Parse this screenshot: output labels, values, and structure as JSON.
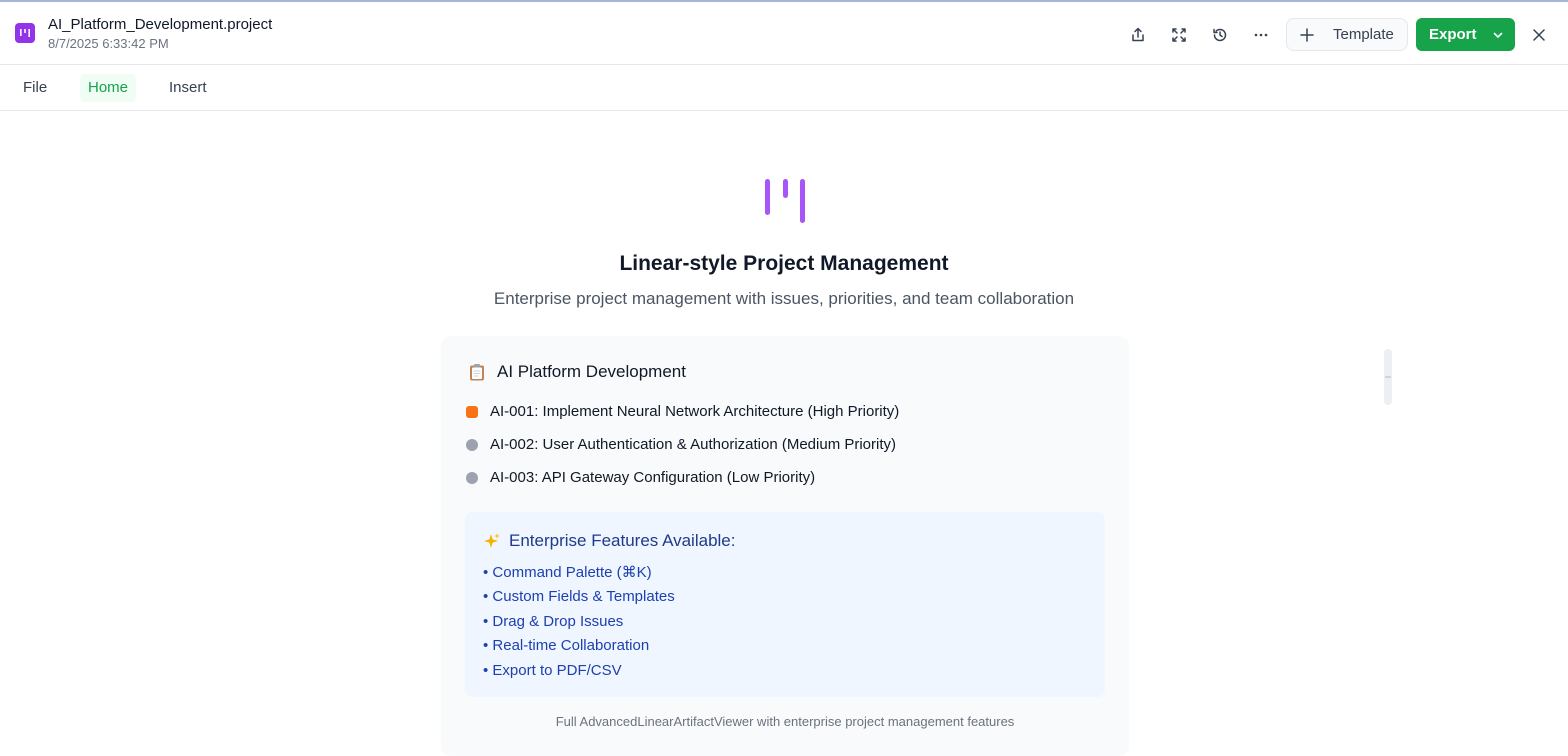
{
  "colors": {
    "accent_purple": "#9333ea",
    "export_green": "#16a34a",
    "priority_high": "#f97316",
    "priority_other": "#9ca3af"
  },
  "header": {
    "app_icon": "linear-logo-icon",
    "file_name": "AI_Platform_Development.project",
    "timestamp": "8/7/2025 6:33:42 PM",
    "icons": [
      "share-icon",
      "fullscreen-icon",
      "history-icon",
      "more-icon"
    ],
    "template_label": "Template",
    "export_label": "Export"
  },
  "menu": {
    "items": [
      {
        "label": "File",
        "active": false
      },
      {
        "label": "Home",
        "active": true
      },
      {
        "label": "Insert",
        "active": false
      }
    ]
  },
  "hero": {
    "title": "Linear-style Project Management",
    "subtitle": "Enterprise project management with issues, priorities, and team collaboration"
  },
  "project": {
    "icon": "clipboard-icon",
    "title": "AI Platform Development",
    "issues": [
      {
        "label": "AI-001: Implement Neural Network Architecture (High Priority)",
        "priority": "high"
      },
      {
        "label": "AI-002: User Authentication & Authorization (Medium Priority)",
        "priority": "medium"
      },
      {
        "label": "AI-003: API Gateway Configuration (Low Priority)",
        "priority": "low"
      }
    ],
    "features_icon": "sparkles-icon",
    "features_title": "Enterprise Features Available:",
    "features": [
      "• Command Palette (⌘K)",
      "• Custom Fields & Templates",
      "• Drag & Drop Issues",
      "• Real-time Collaboration",
      "• Export to PDF/CSV"
    ],
    "footer": "Full AdvancedLinearArtifactViewer with enterprise project management features"
  }
}
